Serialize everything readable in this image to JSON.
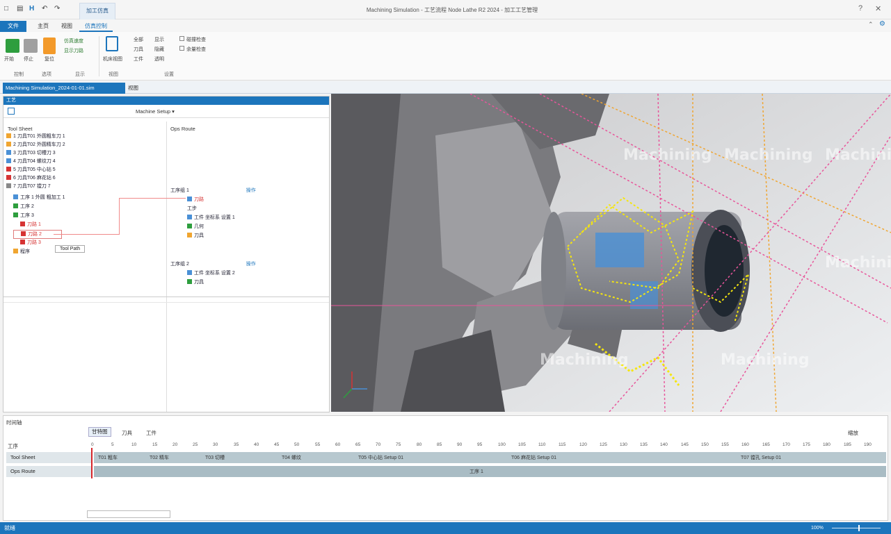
{
  "titlebar": {
    "quick_access": [
      "□",
      "▤",
      "H",
      "↶",
      "↷"
    ],
    "context_tab": "加工仿真",
    "title": "Machining Simulation - 工艺流程 Node Lathe R2 2024 - 加工工艺管理",
    "win_controls": [
      "?",
      "✕"
    ]
  },
  "ribbon_tabs": [
    {
      "label": "文件",
      "style": "active"
    },
    {
      "label": "主页",
      "style": "normal"
    },
    {
      "label": "视图",
      "style": "normal"
    },
    {
      "label": "仿真控制",
      "style": "sel"
    }
  ],
  "ribbon": {
    "start_label": "开始",
    "stop_label": "停止",
    "reset_label": "复位",
    "opt1": "仿真速度",
    "opt2": "显示刀路",
    "big_label": "机床视图",
    "col1": [
      "全部",
      "刀具",
      "工件"
    ],
    "col2": [
      "显示",
      "隐藏",
      "透明"
    ],
    "checks": [
      "碰撞检查",
      "余量检查"
    ],
    "groups": [
      "控制",
      "选项",
      "显示",
      "视图",
      "设置"
    ]
  },
  "doctab": {
    "label": "Machining Simulation_2024-01-01.sim",
    "extra": "视图"
  },
  "leftpanel": {
    "header": "工艺",
    "dropdown": "Machine Setup",
    "left_head": "Tool Sheet",
    "right_head": "Ops Route",
    "tree": [
      "1  刀具T01 外圆粗车刀 1",
      "2  刀具T02 外圆精车刀 2",
      "3  刀具T03 切槽刀 3",
      "4  刀具T04 螺纹刀 4",
      "5  刀具T05 中心钻 5",
      "6  刀具T06 麻花钻 6",
      "7  刀具T07 镗刀 7"
    ],
    "sub_items": [
      "工序 1 外圆 粗加工 1",
      "工序 2",
      "工序 3",
      "刀路 1",
      "刀路 2",
      "刀路 3",
      "程序"
    ],
    "tooltip": "Tool Path",
    "ops_group1": {
      "title": "工序组 1",
      "btn": "操作",
      "items": [
        "刀路",
        "工步",
        "工件 坐标系 设置 1",
        "几何",
        "刀具"
      ]
    },
    "ops_group2": {
      "title": "工序组 2",
      "btn": "操作",
      "items": [
        "工件 坐标系 设置 2",
        "刀具"
      ]
    }
  },
  "viewport": {
    "watermarks": [
      "Machining",
      "Machining",
      "Machining",
      "Machining",
      "Machining",
      "Machining"
    ],
    "colors": {
      "path_pink": "#e8559a",
      "path_orange": "#f0a530",
      "path_yellow": "#f5e60d",
      "part_blue": "#4a90d6"
    }
  },
  "timeline": {
    "header": "时间轴",
    "tabs": [
      "甘特图",
      "刀具",
      "工件"
    ],
    "right_btn": "缩放",
    "row_label_head": "工序",
    "ticks": [
      "0",
      "5",
      "10",
      "15",
      "20",
      "25",
      "30",
      "35",
      "40",
      "45",
      "50",
      "55",
      "60",
      "65",
      "70",
      "75",
      "80",
      "85",
      "90",
      "95",
      "100",
      "105",
      "110",
      "115",
      "120",
      "125",
      "130",
      "135",
      "140",
      "145",
      "150",
      "155",
      "160",
      "165",
      "170",
      "175",
      "180",
      "185",
      "190"
    ],
    "rows": [
      {
        "label": "Tool Sheet",
        "segments": [
          "T01 粗车",
          "T02 精车",
          "T03 切槽",
          "T04 螺纹",
          "T05 中心钻 Setup 01",
          "T06 麻花钻 Setup 01",
          "T07 镗孔 Setup 01"
        ]
      },
      {
        "label": "Ops Route",
        "segments": [
          "工序 1"
        ]
      }
    ],
    "footer_field": ""
  },
  "statusbar": {
    "left": "就绪",
    "zoom": "100%"
  }
}
